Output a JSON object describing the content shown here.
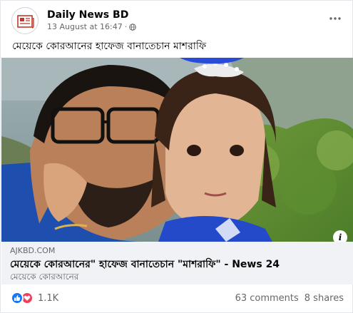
{
  "post": {
    "page_name": "Daily News BD",
    "timestamp": "13 August at 16:47",
    "separator": "·",
    "caption": "মেয়েকে কোরআনের হাফেজ বানাতেচান মাশরাফি"
  },
  "link_preview": {
    "domain": "AJKBD.COM",
    "title": "মেয়েকে কোরআনের\" হাফেজ বানাতেচান \"মাশরাফি\" - News 24",
    "description": "মেয়েকে কোরআনের"
  },
  "stats": {
    "reaction_count": "1.1K",
    "comments": "63 comments",
    "shares": "8 shares"
  },
  "icons": {
    "avatar": "newspaper-icon",
    "privacy": "globe-icon",
    "menu": "more-options-icon",
    "info": "info-icon",
    "like": "like-reaction-icon",
    "love": "love-reaction-icon"
  },
  "colors": {
    "like": "#1877f2",
    "love": "#f33e58",
    "secondary_text": "#65676b",
    "link_box_bg": "#f0f2f5"
  }
}
